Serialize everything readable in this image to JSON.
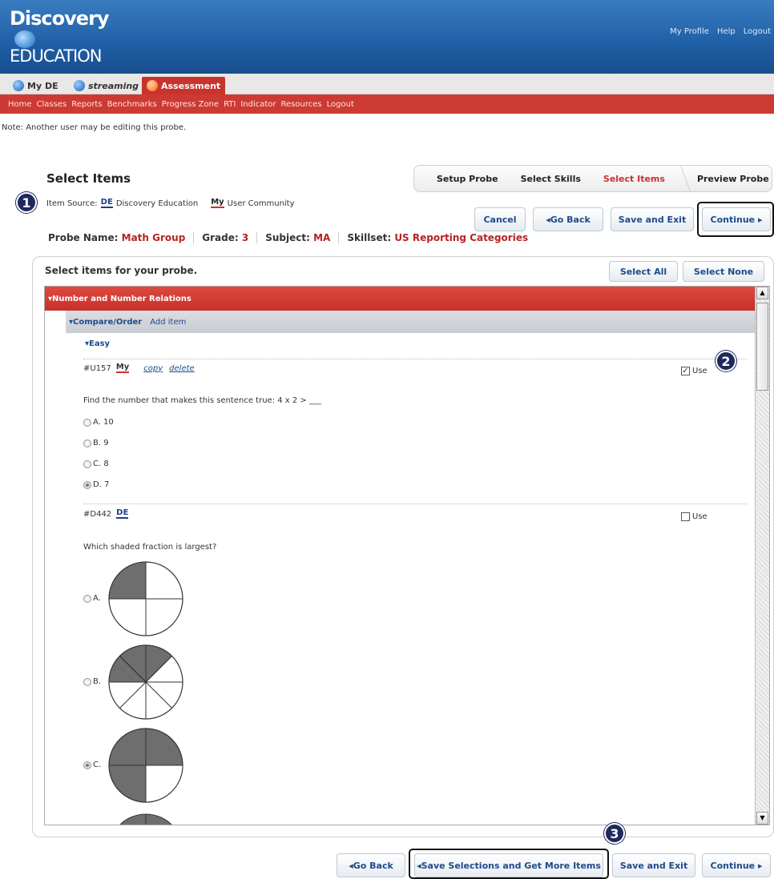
{
  "brand": {
    "line1": "Discovery",
    "line2": "EDUCATION"
  },
  "top_links": [
    "My Profile",
    "Help",
    "Logout"
  ],
  "tabs": [
    {
      "label": "My DE",
      "icon": "globe-icon"
    },
    {
      "label": "streaming",
      "icon": "streaming-icon"
    },
    {
      "label": "Assessment",
      "icon": "assessment-icon"
    }
  ],
  "nav": [
    "Home",
    "Classes",
    "Reports",
    "Benchmarks",
    "Progress Zone",
    "RTI",
    "Indicator",
    "Resources",
    "Logout"
  ],
  "note": "Note: Another user may be editing this probe.",
  "page_title": "Select Items",
  "badges": [
    "1",
    "2",
    "3"
  ],
  "item_source": {
    "label": "Item Source:",
    "de_badge": "DE",
    "de_label": "Discovery Education",
    "my_badge": "My",
    "my_label": "User Community"
  },
  "steps": [
    "Setup Probe",
    "Select Skills",
    "Select Items",
    "Preview Probe"
  ],
  "buttons": {
    "cancel": "Cancel",
    "go_back": "◂Go Back",
    "save_exit": "Save and Exit",
    "continue": "Continue ▸",
    "select_all": "Select All",
    "select_none": "Select None",
    "save_selections": "◂Save Selections and Get More Items"
  },
  "probe_info": {
    "name_label": "Probe Name:",
    "name_value": "Math Group",
    "grade_label": "Grade:",
    "grade_value": "3",
    "subject_label": "Subject:",
    "subject_value": "MA",
    "skillset_label": "Skillset:",
    "skillset_value": "US Reporting Categories"
  },
  "panel_title": "Select items for your probe.",
  "category": "▾Number and Number Relations",
  "subcategory": {
    "label": "▾Compare/Order",
    "add": "Add item"
  },
  "difficulty": "▾Easy",
  "items": [
    {
      "id": "#U157",
      "badge": "My",
      "copy": "copy",
      "delete": "delete",
      "use_label": "Use",
      "checked": true,
      "question": "Find the number that makes this sentence true: 4 x 2 > ___",
      "options": [
        "A. 10",
        "B. 9",
        "C. 8",
        "D. 7"
      ]
    },
    {
      "id": "#D442",
      "badge": "DE",
      "use_label": "Use",
      "checked": false,
      "question": "Which shaded fraction is largest?",
      "options": [
        "A.",
        "B.",
        "C."
      ]
    }
  ],
  "colors": {
    "header": "#1f5fa6",
    "nav_red": "#cc3a33",
    "accent_red": "#b32421",
    "link_blue": "#1e4a8c",
    "badge": "#1e2a5e"
  }
}
